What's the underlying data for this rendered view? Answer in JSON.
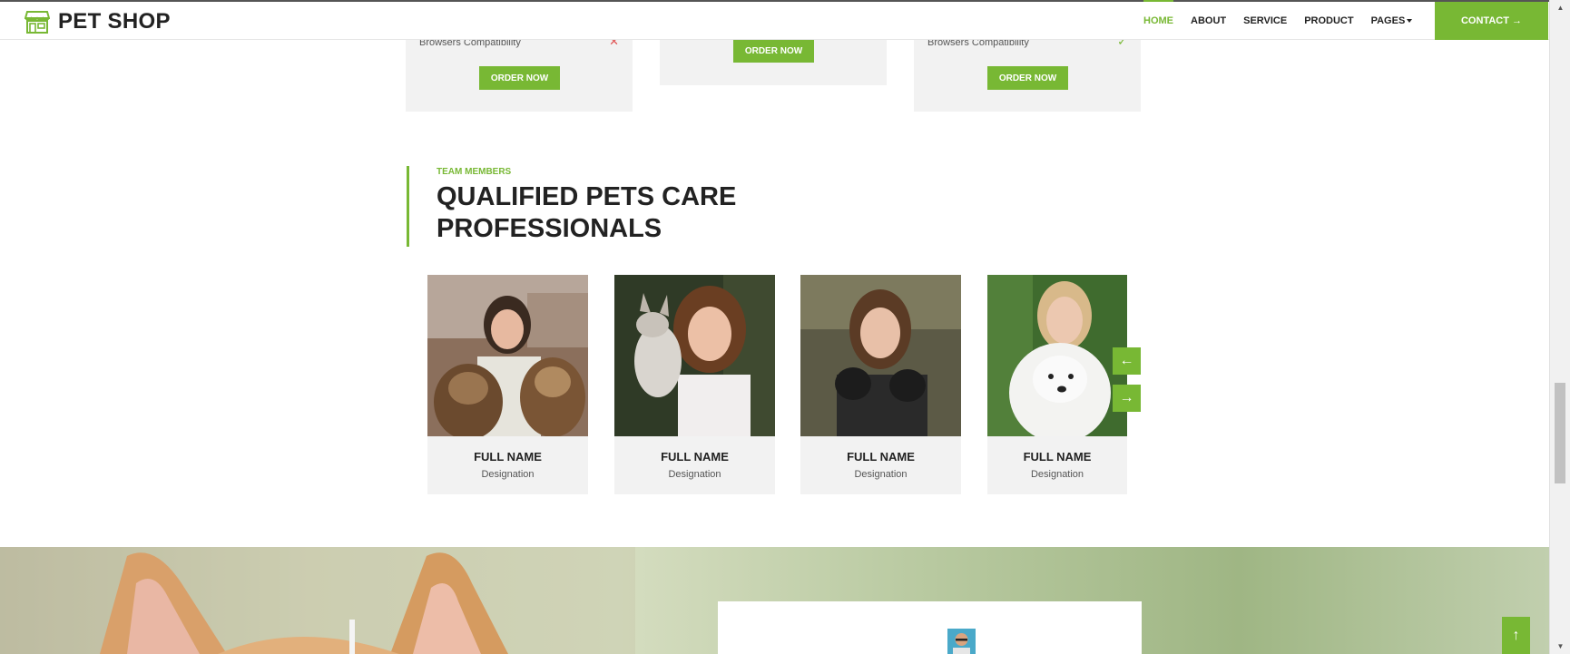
{
  "brand": {
    "name": "PET SHOP",
    "icon": "storefront-icon"
  },
  "nav": {
    "items": [
      {
        "label": "HOME",
        "active": true
      },
      {
        "label": "ABOUT"
      },
      {
        "label": "SERVICE"
      },
      {
        "label": "PRODUCT"
      },
      {
        "label": "PAGES"
      }
    ],
    "contact_label": "CONTACT →"
  },
  "pricing": {
    "cards": [
      {
        "feature": "Browsers Compatibility",
        "mark": "✕",
        "order_label": "ORDER NOW"
      },
      {
        "order_label": "ORDER NOW"
      },
      {
        "feature": "Browsers Compatibility",
        "mark": "✓",
        "order_label": "ORDER NOW"
      }
    ]
  },
  "team": {
    "eyebrow": "TEAM MEMBERS",
    "title": "QUALIFIED PETS CARE PROFESSIONALS",
    "members": [
      {
        "name": "FULL NAME",
        "designation": "Designation"
      },
      {
        "name": "FULL NAME",
        "designation": "Designation"
      },
      {
        "name": "FULL NAME",
        "designation": "Designation"
      },
      {
        "name": "FULL NAME",
        "designation": "Designation"
      }
    ],
    "prev_icon": "arrow-left-icon",
    "next_icon": "arrow-right-icon"
  },
  "colors": {
    "accent": "#78b834",
    "card_bg": "#f2f2f2",
    "text": "#222222"
  }
}
